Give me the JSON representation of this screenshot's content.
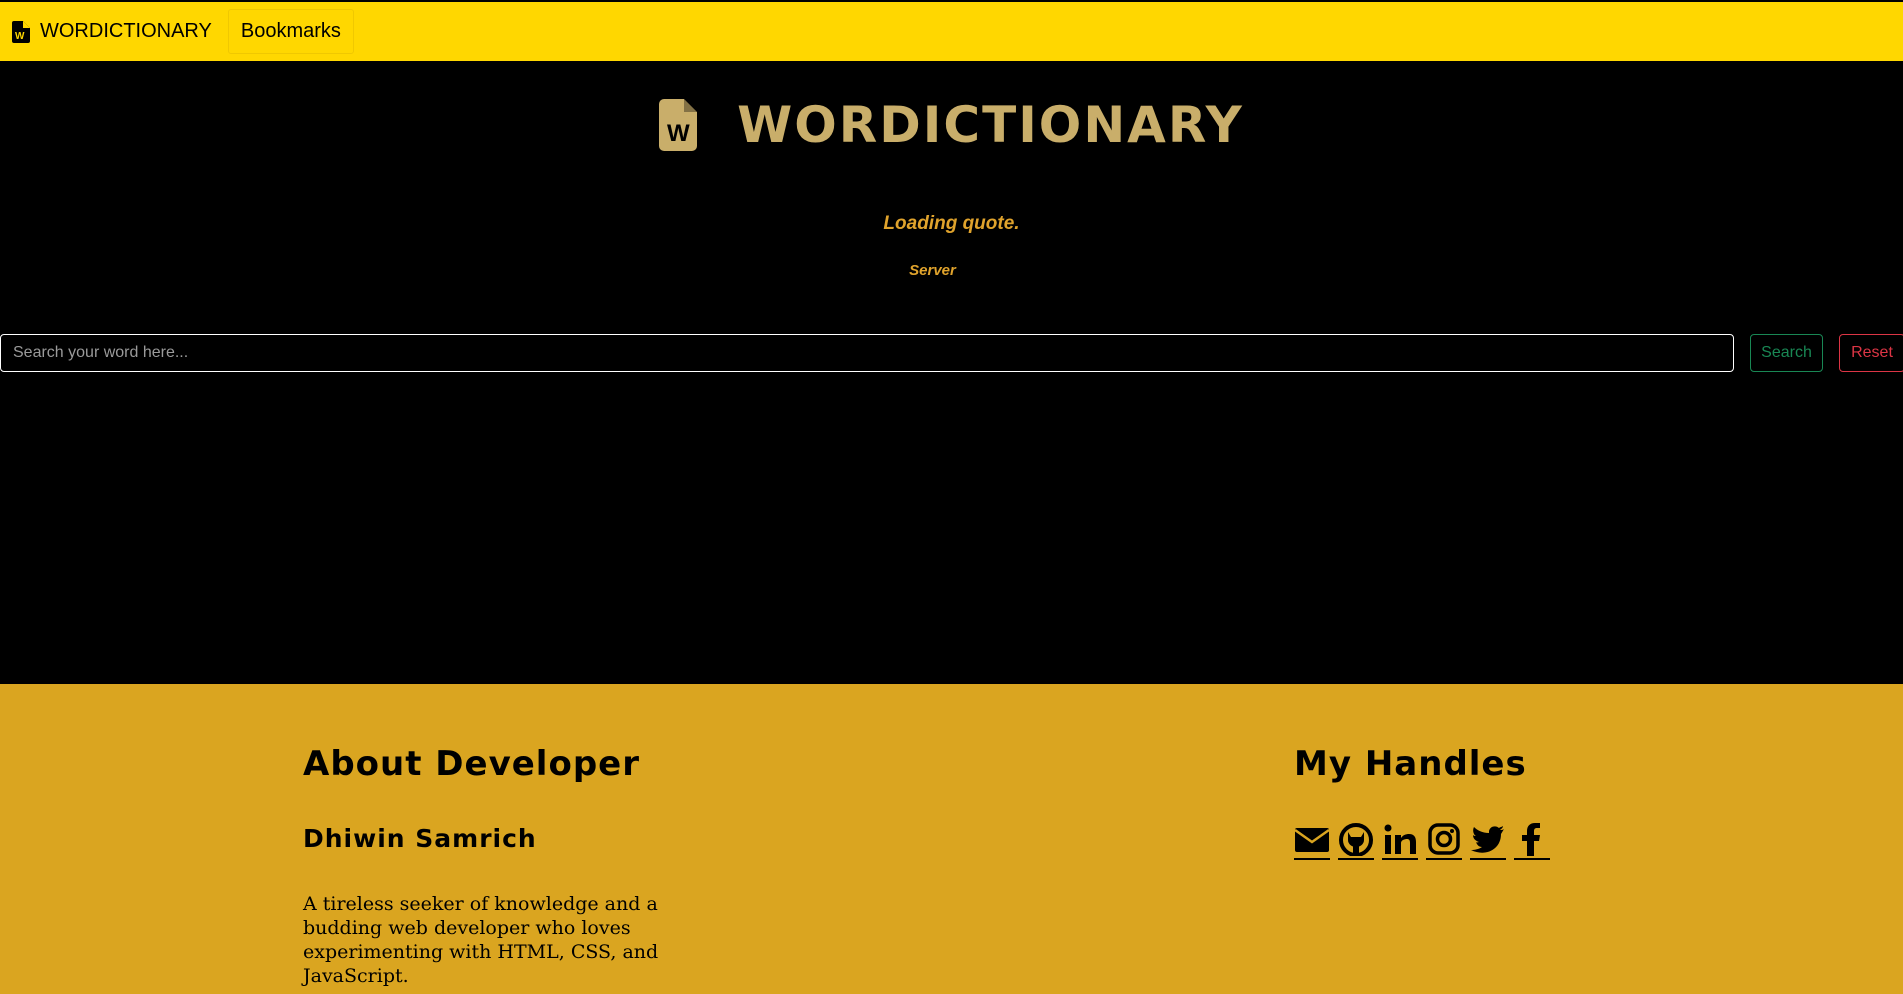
{
  "navbar": {
    "brand": "WORDICTIONARY",
    "brand_icon": "file-word-icon",
    "bookmarks_label": "Bookmarks"
  },
  "hero": {
    "title": "WORDICTIONARY",
    "icon": "file-word-icon"
  },
  "quote": {
    "text": "Loading quote.",
    "author": "Server"
  },
  "search": {
    "placeholder": "Search your word here...",
    "value": "",
    "search_label": "Search",
    "reset_label": "Reset"
  },
  "footer": {
    "about_heading": "About Developer",
    "developer_name": "Dhiwin Samrich",
    "bio": "A tireless seeker of knowledge and a budding web developer who loves experimenting with HTML, CSS, and JavaScript.",
    "handles_heading": "My Handles",
    "handles": [
      "envelope-icon",
      "github-icon",
      "linkedin-icon",
      "instagram-icon",
      "twitter-icon",
      "facebook-icon"
    ]
  },
  "colors": {
    "navbar_bg": "#FFD700",
    "page_bg": "#000000",
    "title_gold": "#C9AE6A",
    "quote_orange": "#E0A32C",
    "footer_bg": "#DAA520",
    "search_green": "#198754",
    "reset_red": "#DC3545"
  }
}
